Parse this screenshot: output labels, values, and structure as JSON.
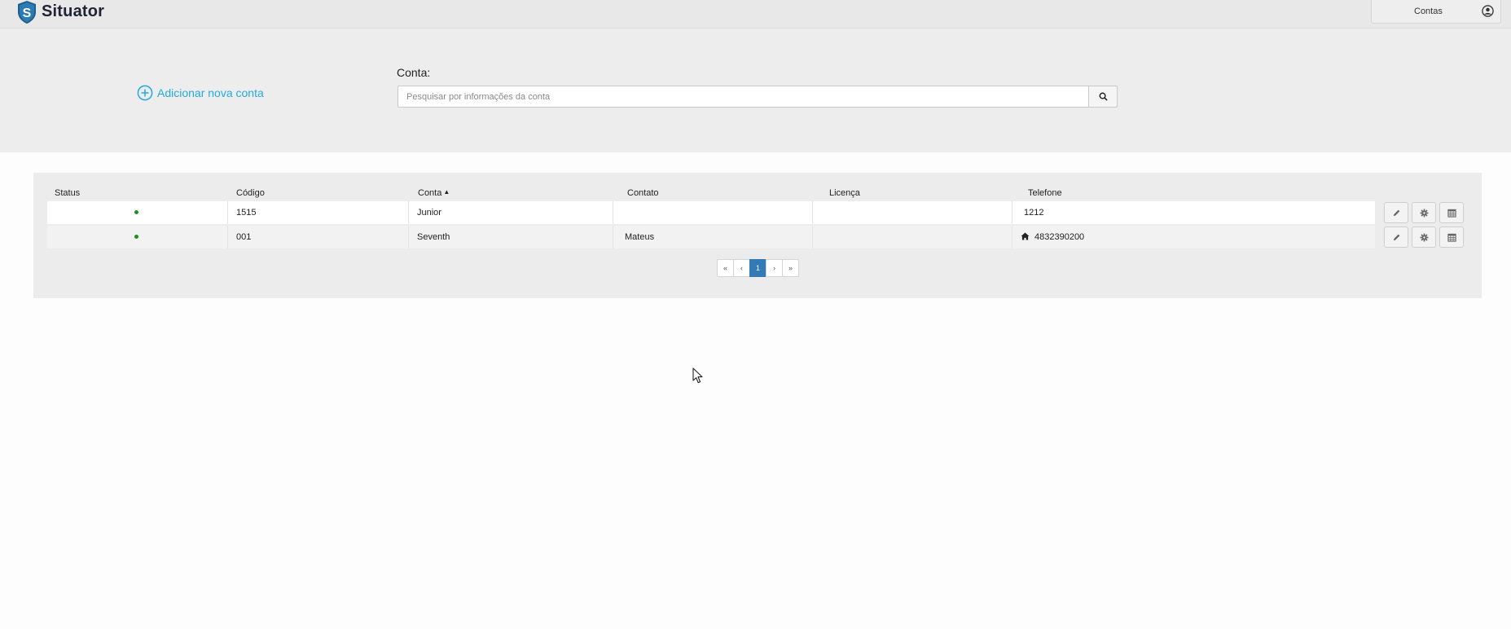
{
  "app": {
    "name": "Situator"
  },
  "navbar": {
    "contas_label": "Contas",
    "user_icon": "user-circle-icon"
  },
  "search": {
    "add_account_label": "Adicionar nova conta",
    "label": "Conta:",
    "placeholder": "Pesquisar por informações da conta",
    "button_icon": "search-icon"
  },
  "table": {
    "columns": {
      "status": "Status",
      "codigo": "Código",
      "conta": "Conta",
      "contato": "Contato",
      "licenca": "Licença",
      "telefone": "Telefone"
    },
    "sort": {
      "column": "conta",
      "direction": "ascending"
    },
    "rows": [
      {
        "status": "active",
        "codigo": "1515",
        "conta": "Junior",
        "contato": "",
        "licenca": "",
        "telefone": "1212",
        "phone_icon": ""
      },
      {
        "status": "active",
        "codigo": "001",
        "conta": "Seventh",
        "contato": "Mateus",
        "licenca": "",
        "telefone": "4832390200",
        "phone_icon": "home-icon"
      }
    ],
    "row_actions": [
      "pencil-icon",
      "gear-icon",
      "calendar-icon"
    ]
  },
  "pagination": {
    "first": "«",
    "prev": "‹",
    "pages": [
      "1"
    ],
    "current": "1",
    "next": "›",
    "last": "»"
  },
  "colors": {
    "accent_link": "#25a9e0",
    "pagination_active": "#337ab7",
    "status_active": "#1f8f1f",
    "logo_shield": "#1f5e8e"
  }
}
